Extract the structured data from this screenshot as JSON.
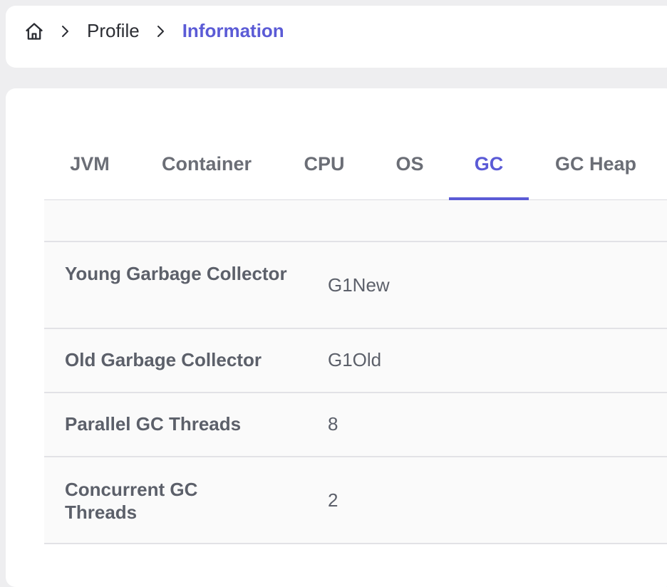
{
  "breadcrumb": {
    "home_icon": "home-icon",
    "items": [
      "Profile",
      "Information"
    ]
  },
  "tabs": [
    {
      "label": "JVM",
      "active": false
    },
    {
      "label": "Container",
      "active": false
    },
    {
      "label": "CPU",
      "active": false
    },
    {
      "label": "OS",
      "active": false
    },
    {
      "label": "GC",
      "active": true
    },
    {
      "label": "GC Heap",
      "active": false
    }
  ],
  "gc_table": {
    "rows": [
      {
        "label": "Young Garbage Collector",
        "value": "G1New"
      },
      {
        "label": "Old Garbage Collector",
        "value": "G1Old"
      },
      {
        "label": "Parallel GC Threads",
        "value": "8"
      },
      {
        "label": "Concurrent GC Threads",
        "value": "2"
      }
    ]
  },
  "colors": {
    "accent": "#5b5bd6",
    "text": "#5c606a",
    "background": "#eeeef0"
  }
}
